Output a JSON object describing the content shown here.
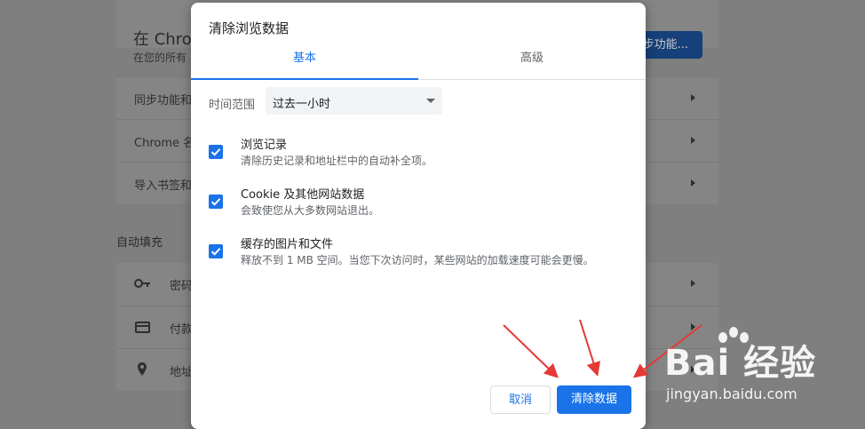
{
  "background": {
    "section_title": "在 Chrom",
    "section_sub": "在您的所有",
    "sync_button": "步功能...",
    "rows_top": [
      "同步功能和",
      "Chrome 名",
      "导入书签和"
    ],
    "autofill_header": "自动填充",
    "rows_autofill": [
      "密码",
      "付款",
      "地址"
    ]
  },
  "dialog": {
    "title": "清除浏览数据",
    "tabs": [
      {
        "label": "基本",
        "active": true
      },
      {
        "label": "高级",
        "active": false
      }
    ],
    "time_range": {
      "label": "时间范围",
      "value": "过去一小时"
    },
    "options": [
      {
        "label": "浏览记录",
        "desc": "清除历史记录和地址栏中的自动补全项。",
        "checked": true
      },
      {
        "label": "Cookie 及其他网站数据",
        "desc": "会致使您从大多数网站退出。",
        "checked": true
      },
      {
        "label": "缓存的图片和文件",
        "desc": "释放不到 1 MB 空间。当您下次访问时，某些网站的加载速度可能会更慢。",
        "checked": true
      }
    ],
    "buttons": {
      "cancel": "取消",
      "clear": "清除数据"
    }
  },
  "watermark": {
    "logo": "Bai 经验",
    "sub": "jingyan.baidu.com"
  },
  "colors": {
    "accent": "#1a73e8",
    "annotation": "#e53935",
    "overlay": "#7f7f7f"
  }
}
